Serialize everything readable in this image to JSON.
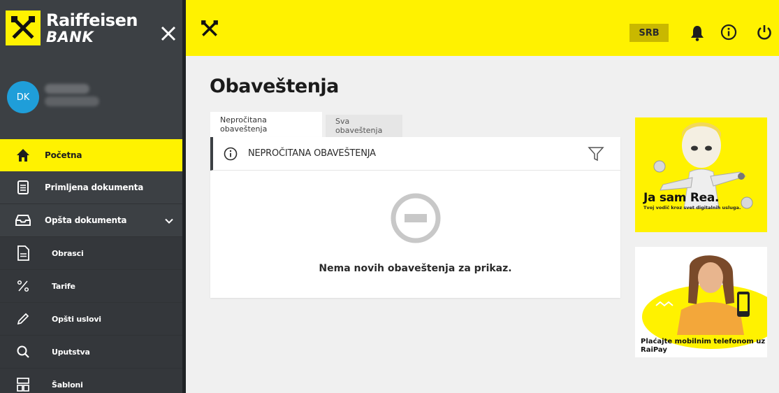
{
  "brand": {
    "name_line1": "Raiffeisen",
    "name_line2": "BANK",
    "yellow": "#fff200",
    "dark": "#3c4044"
  },
  "user": {
    "initials": "DK"
  },
  "sidebar": {
    "items": [
      {
        "label": "Početna",
        "icon": "home-icon",
        "active": true
      },
      {
        "label": "Primljena dokumenta",
        "icon": "document-list-icon"
      },
      {
        "label": "Opšta dokumenta",
        "icon": "inbox-icon",
        "expandable": true
      },
      {
        "label": "Obrasci",
        "icon": "form-icon",
        "sub": true
      },
      {
        "label": "Tarife",
        "icon": "percent-icon",
        "sub": true
      },
      {
        "label": "Opšti uslovi",
        "icon": "pencil-icon",
        "sub": true
      },
      {
        "label": "Uputstva",
        "icon": "search-icon",
        "sub": true
      },
      {
        "label": "Šabloni",
        "icon": "template-icon",
        "sub": true
      }
    ]
  },
  "topbar": {
    "language": "SRB"
  },
  "main": {
    "title": "Obaveštenja",
    "tabs": [
      {
        "label": "Nepročitana obaveštenja",
        "active": true
      },
      {
        "label": "Sva obaveštenja"
      }
    ],
    "panel": {
      "title": "NEPROČITANA OBAVEŠTENJA",
      "empty_message": "Nema novih obaveštenja za prikaz."
    }
  },
  "promos": [
    {
      "title": "Ja sam Rea.",
      "subtitle": "Tvoj vodič kroz svet digitalnih usluga."
    },
    {
      "caption": "Plaćajte mobilnim telefonom uz RaiPay"
    }
  ]
}
